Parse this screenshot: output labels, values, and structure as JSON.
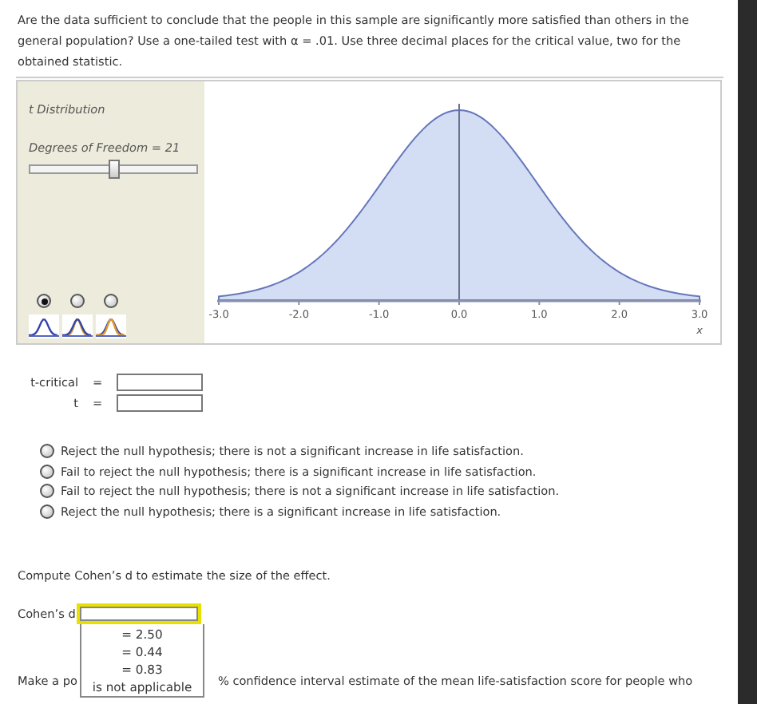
{
  "question": {
    "text": "Are the data sufficient to conclude that the people in this sample are significantly more satisfied than others in the general population? Use a one-tailed test with α = .01. Use three decimal places for the critical value, two for the obtained statistic."
  },
  "widget": {
    "title": "t Distribution",
    "dof_label": "Degrees of Freedom = 21",
    "dof_slider": {
      "level": 0.5
    },
    "curve_options": [
      {
        "kind": "t-only",
        "selected": true
      },
      {
        "kind": "t-vs-normal",
        "selected": false
      },
      {
        "kind": "normal-vs-t",
        "selected": false
      }
    ],
    "x_ticks": [
      "-3.0",
      "-2.0",
      "-1.0",
      "0.0",
      "1.0",
      "2.0",
      "3.0"
    ],
    "x_label": "x"
  },
  "answer_fields": [
    {
      "label": "t-critical",
      "sign": "="
    },
    {
      "label": "t",
      "sign": "="
    }
  ],
  "choices": [
    {
      "text": "Reject the null hypothesis; there is not a significant increase in life satisfaction.",
      "selected": false
    },
    {
      "text": "Fail to reject the null hypothesis; there is a significant increase in life satisfaction.",
      "selected": false
    },
    {
      "text": "Fail to reject the null hypothesis; there is not a significant increase in life satisfaction.",
      "selected": false
    },
    {
      "text": "Reject the null hypothesis; there is a significant increase in life satisfaction.",
      "selected": false
    }
  ],
  "effect_size": {
    "prompt": "Compute Cohen’s d to estimate the size of the effect.",
    "label": "Cohen’s d",
    "focused": true,
    "options": [
      "= 2.50",
      "= 0.44",
      "= 0.83",
      "is not applicable"
    ]
  },
  "next_question": {
    "start": "Make a po",
    "rest": "% confidence interval estimate of the mean life-satisfaction score for people who"
  }
}
